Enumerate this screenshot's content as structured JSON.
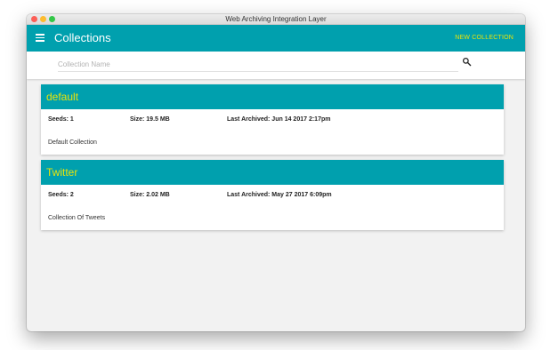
{
  "window": {
    "title": "Web Archiving Integration Layer"
  },
  "appbar": {
    "title": "Collections",
    "new_collection_label": "NEW COLLECTION"
  },
  "search": {
    "placeholder": "Collection Name",
    "value": ""
  },
  "collections": [
    {
      "name": "default",
      "seeds": "Seeds: 1",
      "size": "Size: 19.5 MB",
      "last_archived": "Last Archived: Jun 14 2017 2:17pm",
      "description": "Default Collection"
    },
    {
      "name": "Twitter",
      "seeds": "Seeds: 2",
      "size": "Size: 2.02 MB",
      "last_archived": "Last Archived: May 27 2017 6:09pm",
      "description": "Collection Of Tweets"
    }
  ],
  "colors": {
    "primary": "#00a0ae",
    "accent": "#e9e30a",
    "background": "#f2f2f2"
  },
  "icons": {
    "menu": "hamburger-menu-icon",
    "search": "search-icon"
  }
}
